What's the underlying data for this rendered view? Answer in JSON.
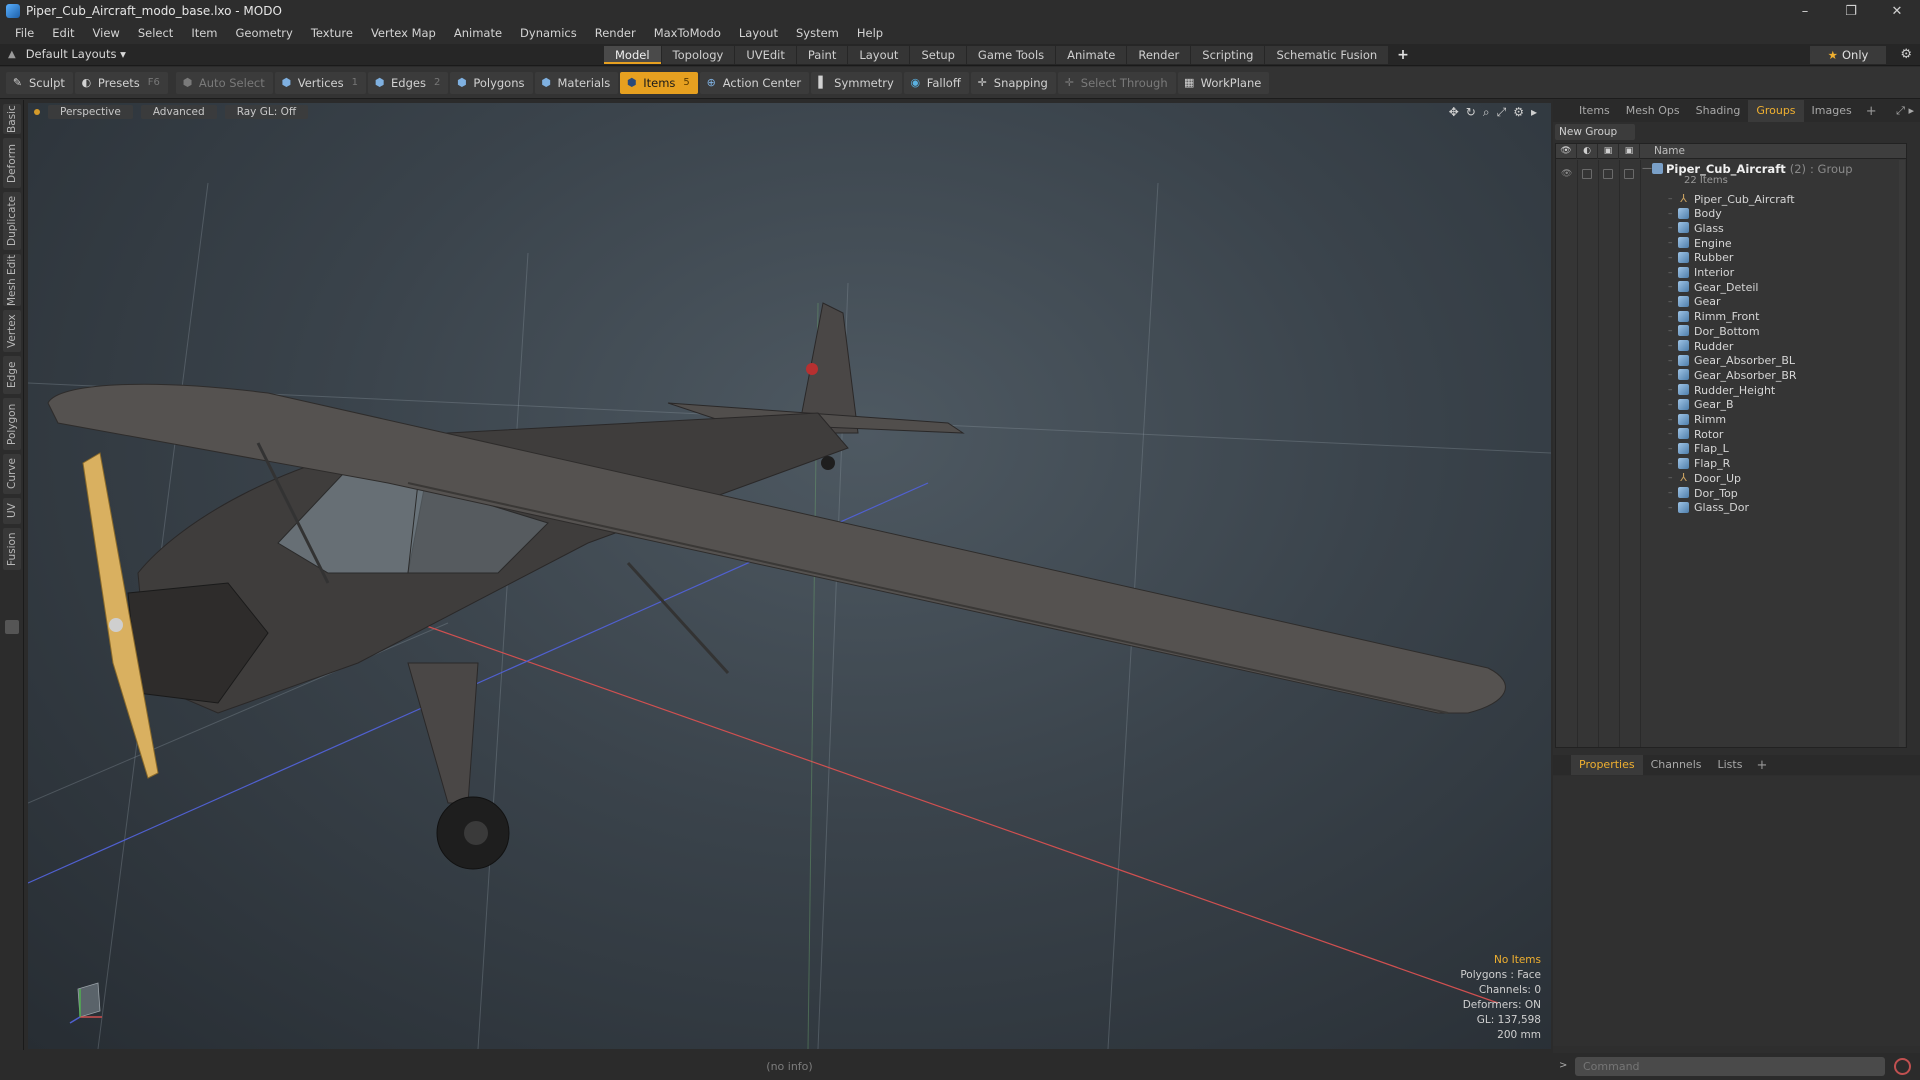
{
  "window": {
    "title": "Piper_Cub_Aircraft_modo_base.lxo - MODO",
    "minimize": "–",
    "maximize": "❐",
    "close": "✕"
  },
  "menu": [
    "File",
    "Edit",
    "View",
    "Select",
    "Item",
    "Geometry",
    "Texture",
    "Vertex Map",
    "Animate",
    "Dynamics",
    "Render",
    "MaxToModo",
    "Layout",
    "System",
    "Help"
  ],
  "layouts": {
    "label": "Default Layouts ▾",
    "tabs": [
      "Model",
      "Topology",
      "UVEdit",
      "Paint",
      "Layout",
      "Setup",
      "Game Tools",
      "Animate",
      "Render",
      "Scripting",
      "Schematic Fusion"
    ],
    "active_tab": "Model",
    "plus": "+",
    "only_label": "Only"
  },
  "toolbar": {
    "sculpt": "Sculpt",
    "presets": "Presets",
    "presets_key": "F6",
    "auto_select": "Auto Select",
    "vertices": "Vertices",
    "vertices_key": "1",
    "edges": "Edges",
    "edges_key": "2",
    "polygons": "Polygons",
    "materials": "Materials",
    "items": "Items",
    "items_key": "5",
    "action_center": "Action Center",
    "symmetry": "Symmetry",
    "falloff": "Falloff",
    "snapping": "Snapping",
    "select_through": "Select Through",
    "workplane": "WorkPlane"
  },
  "left_tabs": [
    "Basic",
    "Deform",
    "Duplicate",
    "Mesh Edit",
    "Vertex",
    "Edge",
    "Polygon",
    "Curve",
    "UV",
    "Fusion"
  ],
  "viewport": {
    "view": "Perspective",
    "shading": "Advanced",
    "raygl": "Ray GL: Off",
    "info": {
      "selection": "No Items",
      "polygons": "Polygons : Face",
      "channels": "Channels: 0",
      "deformers": "Deformers: ON",
      "gl": "GL: 137,598",
      "scale": "200 mm"
    }
  },
  "status": "(no info)",
  "right_panel": {
    "tabs": [
      "Items",
      "Mesh Ops",
      "Shading",
      "Groups",
      "Images"
    ],
    "active_tab": "Groups",
    "new_group": "New Group",
    "name_col": "Name",
    "root": {
      "name": "Piper_Cub_Aircraft",
      "count": "(2)",
      "type": ": Group",
      "sub": "22 Items"
    },
    "items": [
      {
        "name": "Piper_Cub_Aircraft",
        "kind": "locator"
      },
      {
        "name": "Body",
        "kind": "mesh"
      },
      {
        "name": "Glass",
        "kind": "mesh"
      },
      {
        "name": "Engine",
        "kind": "mesh"
      },
      {
        "name": "Rubber",
        "kind": "mesh"
      },
      {
        "name": "Interior",
        "kind": "mesh"
      },
      {
        "name": "Gear_Deteil",
        "kind": "mesh"
      },
      {
        "name": "Gear",
        "kind": "mesh"
      },
      {
        "name": "Rimm_Front",
        "kind": "mesh"
      },
      {
        "name": "Dor_Bottom",
        "kind": "mesh"
      },
      {
        "name": "Rudder",
        "kind": "mesh"
      },
      {
        "name": "Gear_Absorber_BL",
        "kind": "mesh"
      },
      {
        "name": "Gear_Absorber_BR",
        "kind": "mesh"
      },
      {
        "name": "Rudder_Height",
        "kind": "mesh"
      },
      {
        "name": "Gear_B",
        "kind": "mesh"
      },
      {
        "name": "Rimm",
        "kind": "mesh"
      },
      {
        "name": "Rotor",
        "kind": "mesh"
      },
      {
        "name": "Flap_L",
        "kind": "mesh"
      },
      {
        "name": "Flap_R",
        "kind": "mesh"
      },
      {
        "name": "Door_Up",
        "kind": "locator"
      },
      {
        "name": "Dor_Top",
        "kind": "mesh"
      },
      {
        "name": "Glass_Dor",
        "kind": "mesh"
      }
    ],
    "bottom_tabs": [
      "Properties",
      "Channels",
      "Lists"
    ],
    "bottom_active": "Properties",
    "command_placeholder": "Command"
  },
  "colors": {
    "accent": "#e6a020",
    "viewport_bg": "#3a434b"
  }
}
